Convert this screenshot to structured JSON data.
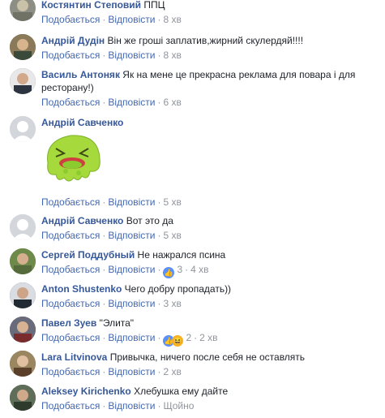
{
  "comments": [
    {
      "author": "Костянтин Степовий",
      "text": "ППЦ",
      "like": "Подобається",
      "reply": "Відповісти",
      "time": "8 хв",
      "avatar_color": "#8e8f84"
    },
    {
      "author": "Андрій Дудін",
      "text": "Він же гроші заплатив,жирний скулердяй!!!!",
      "like": "Подобається",
      "reply": "Відповісти",
      "time": "8 хв",
      "avatar_color": "#7a6a4e"
    },
    {
      "author": "Василь Антоняк",
      "text": "Як на мене це прекрасна реклама для повара і для ресторану!)",
      "like": "Подобається",
      "reply": "Відповісти",
      "time": "6 хв",
      "avatar_color": "#3b4a58"
    },
    {
      "author": "Андрій Савченко",
      "text": "",
      "like": "Подобається",
      "reply": "Відповісти",
      "time": "5 хв",
      "avatar_color": "#c7cbd2",
      "sticker": "green-blob-sick-sticker"
    },
    {
      "author": "Андрій Савченко",
      "text": "Вот это да",
      "like": "Подобається",
      "reply": "Відповісти",
      "time": "5 хв",
      "avatar_color": "#c7cbd2"
    },
    {
      "author": "Сергей Поддубный",
      "text": "Не нажрался псина",
      "like": "Подобається",
      "reply": "Відповісти",
      "time": "4 хв",
      "reaction_count": "3",
      "reactions": [
        "like"
      ],
      "avatar_color": "#5d7a3a"
    },
    {
      "author": "Anton Shustenko",
      "text": "Чего добру пропадать))",
      "like": "Подобається",
      "reply": "Відповісти",
      "time": "3 хв",
      "avatar_color": "#2f3a44"
    },
    {
      "author": "Павел Зуев",
      "text": "\"Элита\"",
      "like": "Подобається",
      "reply": "Відповісти",
      "time": "2 хв",
      "reaction_count": "2",
      "reactions": [
        "like",
        "haha"
      ],
      "avatar_color": "#4b4a5a"
    },
    {
      "author": "Lara Litvinova",
      "text": "Привычка, ничего после себя не оставлять",
      "like": "Подобається",
      "reply": "Відповісти",
      "time": "2 хв",
      "avatar_color": "#6d5a3f"
    },
    {
      "author": "Aleksey Kirichenko",
      "text": "Хлебушка ему дайте",
      "like": "Подобається",
      "reply": "Відповісти",
      "time": "Щойно",
      "avatar_color": "#3e4b3a"
    }
  ],
  "colors": {
    "link": "#4267b2",
    "author": "#365899",
    "meta": "#90949c",
    "like_badge": "#5890ff",
    "haha_badge": "#f7b125"
  }
}
